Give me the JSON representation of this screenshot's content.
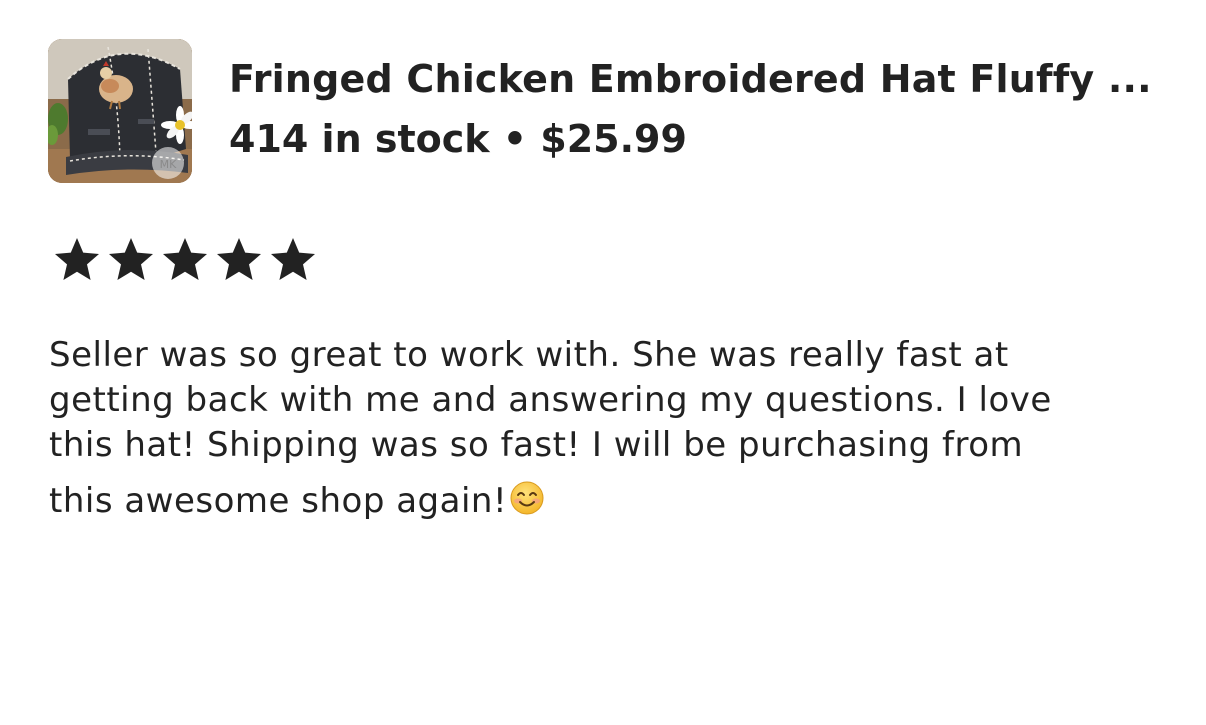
{
  "listing": {
    "title": "Fringed Chicken Embroidered Hat Fluffy ...",
    "stock_and_price": "414 in stock • $25.99",
    "thumbnail_icon": "hat-product-photo",
    "thumbnail_watermark": "MK"
  },
  "review": {
    "rating": 5,
    "rating_max": 5,
    "star_icon": "star-icon",
    "lines": [
      "Seller was so great to work with. She was really fast at",
      "getting back with me and answering my questions. I love",
      "this hat! Shipping was so fast! I will be purchasing from",
      "this awesome shop again!"
    ],
    "emoji_icon": "smiling-face-emoji",
    "emoji": "😊"
  },
  "colors": {
    "text": "#222222",
    "background": "#ffffff",
    "star": "#222222"
  }
}
